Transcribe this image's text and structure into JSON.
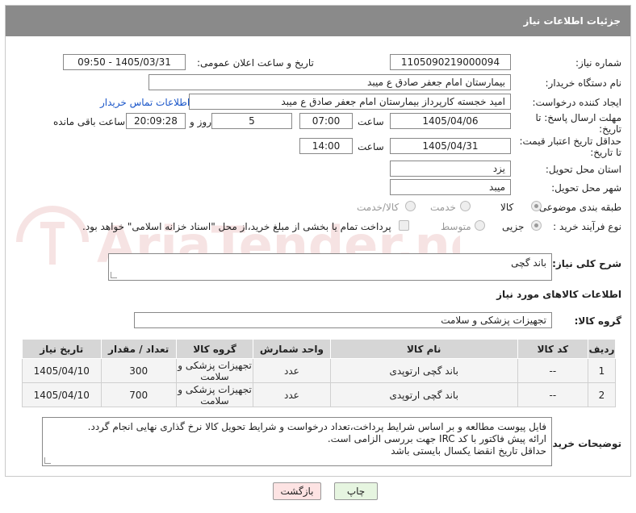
{
  "header": {
    "title": "جزئیات اطلاعات نیاز"
  },
  "form": {
    "need_number_label": "شماره نیاز:",
    "need_number": "1105090219000094",
    "announce_label": "تاریخ و ساعت اعلان عمومی:",
    "announce_value": "1405/03/31 - 09:50",
    "buyer_org_label": "نام دستگاه خریدار:",
    "buyer_org": "بیمارستان امام جعفر صادق  ع  میبد",
    "creator_label": "ایجاد کننده درخواست:",
    "creator": "امید خجسته کارپرداز بیمارستان امام جعفر صادق  ع  میبد",
    "buyer_contact_link": "اطلاعات تماس خریدار",
    "deadline_label_1": "مهلت ارسال پاسخ: تا",
    "deadline_label_2": "تاریخ:",
    "deadline_date": "1405/04/06",
    "time_label": "ساعت",
    "deadline_time": "07:00",
    "days_value": "5",
    "days_label": "روز و",
    "remaining_time": "20:09:28",
    "remaining_label": "ساعت باقی مانده",
    "validity_label_1": "حداقل تاریخ اعتبار قیمت:",
    "validity_label_2": "تا تاریخ:",
    "validity_date": "1405/04/31",
    "validity_time": "14:00",
    "province_label": "استان محل تحویل:",
    "province": "یزد",
    "city_label": "شهر محل تحویل:",
    "city": "میبد",
    "category_label": "طبقه بندی موضوعی:",
    "category_options": [
      "کالا",
      "خدمت",
      "کالا/خدمت"
    ],
    "category_selected": "کالا",
    "process_label": "نوع فرآیند خرید :",
    "process_options": [
      "جزیی",
      "متوسط"
    ],
    "process_selected": "جزیی",
    "payment_note": "پرداخت تمام یا بخشی از مبلغ خرید،از محل \"اسناد خزانه اسلامی\" خواهد بود."
  },
  "description": {
    "label": "شرح کلی نیاز:",
    "value": "باند گچی"
  },
  "goods_info_title": "اطلاعات کالاهای مورد نیاز",
  "goods_group": {
    "label": "گروه کالا:",
    "value": "تجهیزات پزشکی و سلامت"
  },
  "table": {
    "headers": [
      "ردیف",
      "کد کالا",
      "نام کالا",
      "واحد شمارش",
      "گروه کالا",
      "تعداد / مقدار",
      "تاریخ نیاز"
    ],
    "rows": [
      [
        "1",
        "--",
        "باند گچی ارتوپدی",
        "عدد",
        "تجهیزات پزشکی و سلامت",
        "300",
        "1405/04/10"
      ],
      [
        "2",
        "--",
        "باند گچی ارتوپدی",
        "عدد",
        "تجهیزات پزشکی و سلامت",
        "700",
        "1405/04/10"
      ]
    ]
  },
  "buyer_notes": {
    "label": "توضیحات خریدار:",
    "lines": [
      "فایل پیوست مطالعه و بر اساس شرایط پرداخت،تعداد درخواست و شرایط تحویل کالا نرخ گذاری نهایی انجام گردد.",
      "ارائه پیش فاکتور با کد IRC جهت بررسی الزامی است.",
      "حداقل تاریخ انقضا یکسال بایستی باشد"
    ]
  },
  "buttons": {
    "print": "چاپ",
    "back": "بازگشت"
  },
  "watermark": {
    "text": "AriaTender.net"
  },
  "colors": {
    "header_bg": "#8a8a8a",
    "link": "#1a56c9",
    "table_header_bg": "#d6d6d6"
  }
}
